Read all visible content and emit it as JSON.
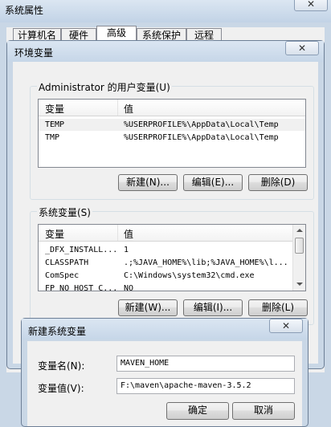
{
  "sysprops": {
    "title": "系统属性",
    "close": "✕",
    "tabs": [
      "计算机名",
      "硬件",
      "高级",
      "系统保护",
      "远程"
    ],
    "active_tab": "高级"
  },
  "envvars": {
    "title": "环境变量",
    "close": "✕",
    "user_section_title": "Administrator 的用户变量(U)",
    "columns": [
      "变量",
      "值"
    ],
    "user_vars": [
      {
        "name": "TEMP",
        "value": "%USERPROFILE%\\AppData\\Local\\Temp"
      },
      {
        "name": "TMP",
        "value": "%USERPROFILE%\\AppData\\Local\\Temp"
      }
    ],
    "user_buttons": {
      "new": "新建(N)...",
      "edit": "编辑(E)...",
      "delete": "删除(D)"
    },
    "system_section_title": "系统变量(S)",
    "system_vars": [
      {
        "name": "_DFX_INSTALL...",
        "value": "1"
      },
      {
        "name": "CLASSPATH",
        "value": ".;%JAVA_HOME%\\lib;%JAVA_HOME%\\l..."
      },
      {
        "name": "ComSpec",
        "value": "C:\\Windows\\system32\\cmd.exe"
      },
      {
        "name": "FP_NO_HOST_C...",
        "value": "NO"
      }
    ],
    "system_buttons": {
      "new": "新建(W)...",
      "edit": "编辑(I)...",
      "delete": "删除(L)"
    }
  },
  "newvar": {
    "title": "新建系统变量",
    "close": "✕",
    "name_label": "变量名(N):",
    "name_value": "MAVEN_HOME",
    "value_label": "变量值(V):",
    "value_value": "F:\\maven\\apache-maven-3.5.2",
    "ok": "确定",
    "cancel": "取消"
  }
}
